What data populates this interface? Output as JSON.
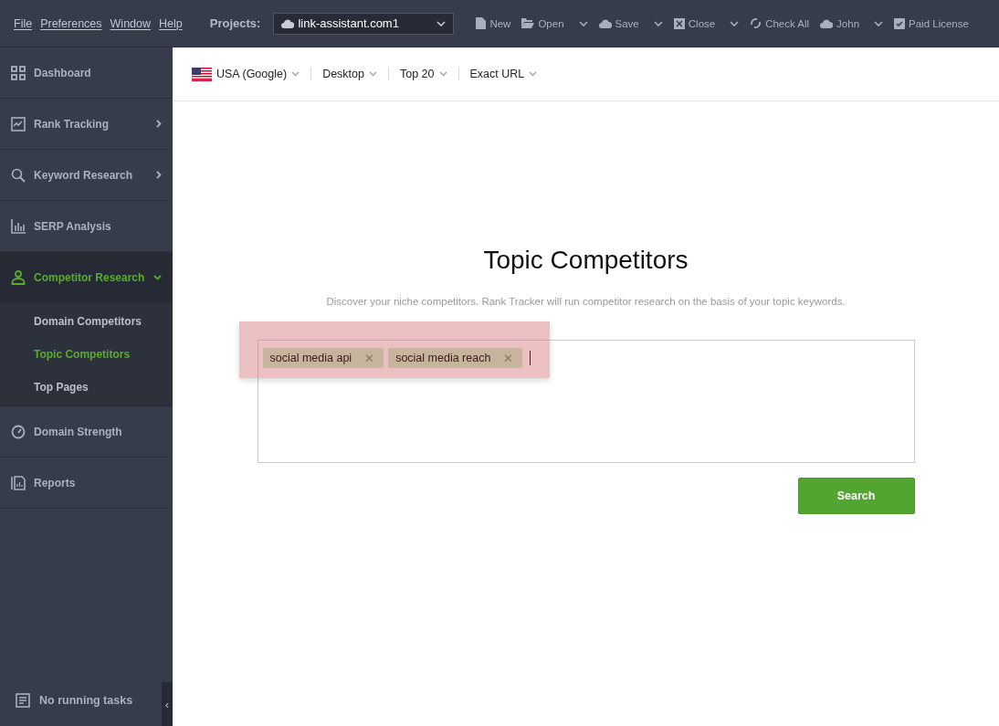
{
  "menu": [
    "File",
    "Preferences",
    "Window",
    "Help"
  ],
  "projects": {
    "label": "Projects:",
    "value": "link-assistant.com1"
  },
  "toolbar": [
    {
      "label": "New",
      "kind": "file",
      "dropdown": false
    },
    {
      "label": "Open",
      "kind": "folder",
      "dropdown": true
    },
    {
      "label": "Save",
      "kind": "cloud",
      "dropdown": true
    },
    {
      "label": "Close",
      "kind": "close",
      "dropdown": true
    },
    {
      "label": "Check All",
      "kind": "refresh",
      "dropdown": false
    },
    {
      "label": "John",
      "kind": "cloud",
      "dropdown": true
    },
    {
      "label": "Paid License",
      "kind": "check",
      "dropdown": false
    }
  ],
  "sidebar": {
    "items": [
      {
        "label": "Dashboard",
        "kind": "grid",
        "selected": false
      },
      {
        "label": "Rank Tracking",
        "kind": "chart",
        "selected": false,
        "expanded": false
      },
      {
        "label": "Keyword Research",
        "kind": "search",
        "selected": false,
        "expanded": false
      },
      {
        "label": "SERP Analysis",
        "kind": "bars",
        "selected": false
      },
      {
        "label": "Competitor Research",
        "kind": "person",
        "selected": true,
        "expanded": true,
        "children": [
          {
            "label": "Domain Competitors",
            "selected": false
          },
          {
            "label": "Topic Competitors",
            "selected": true
          },
          {
            "label": "Top Pages",
            "selected": false
          }
        ]
      },
      {
        "label": "Domain Strength",
        "kind": "gauge",
        "selected": false
      },
      {
        "label": "Reports",
        "kind": "report",
        "selected": false
      }
    ],
    "tasks": "No running tasks",
    "collapse": "‹"
  },
  "filters": [
    {
      "label": "USA (Google)",
      "flag": true
    },
    {
      "label": "Desktop",
      "flag": false
    },
    {
      "label": "Top 20",
      "flag": false
    },
    {
      "label": "Exact URL",
      "flag": false
    }
  ],
  "title": "Topic Competitors",
  "subtitle": "Discover your niche competitors. Rank Tracker will run competitor research on the basis of your topic keywords.",
  "keywords": {
    "highlighted": true,
    "tags": [
      "social media api",
      "social media reach"
    ],
    "remove": "✕"
  },
  "search_button": "Search"
}
